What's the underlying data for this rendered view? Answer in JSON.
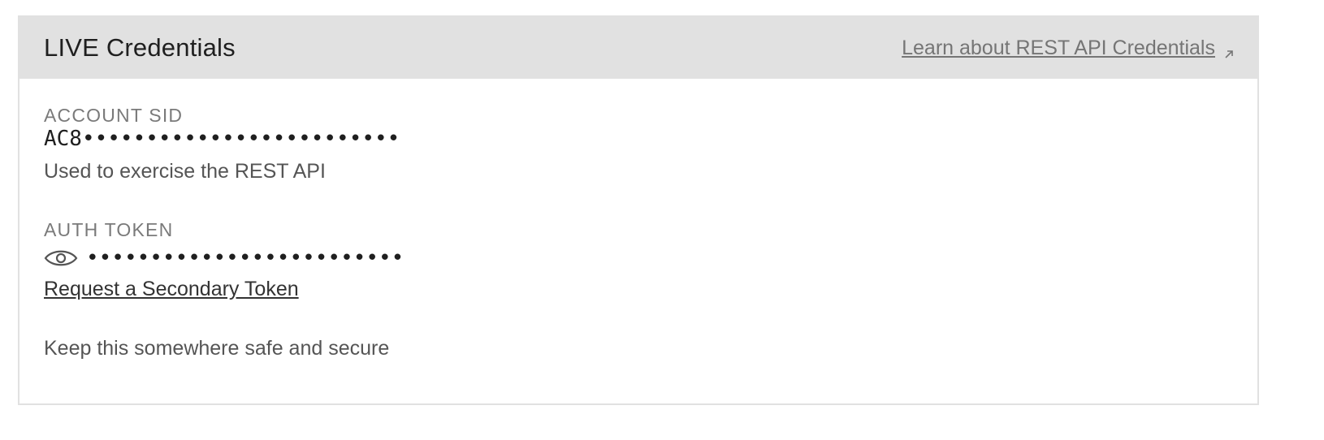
{
  "header": {
    "title": "LIVE Credentials",
    "learn_link": "Learn about REST API Credentials",
    "learn_icon": "external-link-icon"
  },
  "account_sid": {
    "label": "ACCOUNT SID",
    "prefix": "AC8",
    "mask": "•••••••••••••••••••••••••",
    "help": "Used to exercise the REST API"
  },
  "auth_token": {
    "label": "AUTH TOKEN",
    "reveal_icon": "eye-icon",
    "mask": "•••••••••••••••••••••••••",
    "secondary_link": "Request a Secondary Token",
    "help": "Keep this somewhere safe and secure"
  },
  "colors": {
    "header_bg": "#e1e1e1",
    "border": "#e1e1e1",
    "label": "#7a7a7a",
    "text": "#1f1f1f",
    "link": "#757575"
  }
}
